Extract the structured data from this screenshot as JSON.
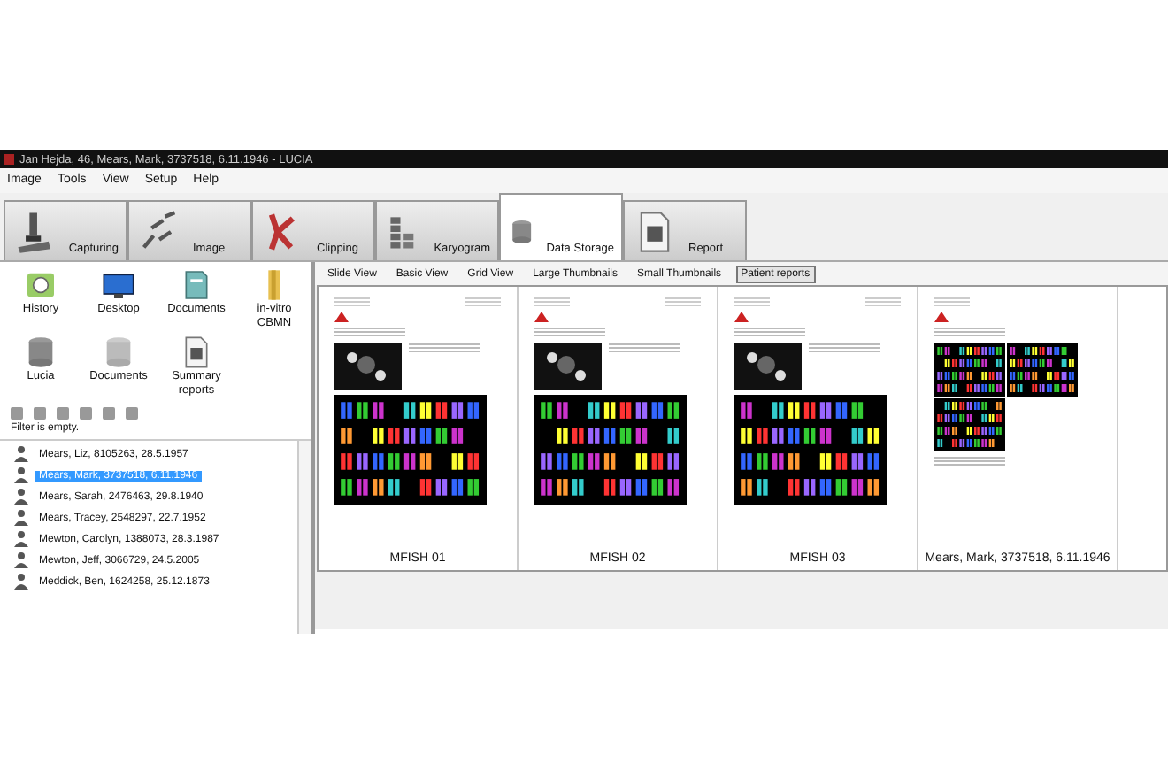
{
  "window": {
    "title": "Jan Hejda, 46, Mears, Mark, 3737518, 6.11.1946 - LUCIA"
  },
  "menu": [
    "Image",
    "Tools",
    "View",
    "Setup",
    "Help"
  ],
  "tabs": [
    {
      "label": "Capturing",
      "kind": "microscope",
      "selected": false
    },
    {
      "label": "Image",
      "kind": "chromosomes",
      "selected": false
    },
    {
      "label": "Clipping",
      "kind": "clip",
      "selected": false
    },
    {
      "label": "Karyogram",
      "kind": "karyogram",
      "selected": false
    },
    {
      "label": "Data Storage",
      "kind": "database",
      "selected": true
    },
    {
      "label": "Report",
      "kind": "report",
      "selected": false
    }
  ],
  "shortcuts": [
    {
      "label": "History",
      "kind": "history"
    },
    {
      "label": "Desktop",
      "kind": "desktop"
    },
    {
      "label": "Documents",
      "kind": "documents"
    },
    {
      "label": "in-vitro CBMN",
      "kind": "folder"
    },
    {
      "label": "Lucia",
      "kind": "database"
    },
    {
      "label": "Documents",
      "kind": "database-grey"
    },
    {
      "label": "Summary reports",
      "kind": "report"
    }
  ],
  "filter_status": "Filter is empty.",
  "patients": [
    {
      "name": "Mears, Liz, 8105263, 28.5.1957",
      "selected": false
    },
    {
      "name": "Mears, Mark, 3737518, 6.11.1946",
      "selected": true
    },
    {
      "name": "Mears, Sarah, 2476463, 29.8.1940",
      "selected": false
    },
    {
      "name": "Mears, Tracey, 2548297, 22.7.1952",
      "selected": false
    },
    {
      "name": "Mewton, Carolyn, 1388073, 28.3.1987",
      "selected": false
    },
    {
      "name": "Mewton, Jeff, 3066729, 24.5.2005",
      "selected": false
    },
    {
      "name": "Meddick, Ben, 1624258, 25.12.1873",
      "selected": false
    }
  ],
  "view_toolbar": [
    {
      "label": "Slide View",
      "selected": false
    },
    {
      "label": "Basic View",
      "selected": false
    },
    {
      "label": "Grid View",
      "selected": false
    },
    {
      "label": "Large Thumbnails",
      "selected": false
    },
    {
      "label": "Small Thumbnails",
      "selected": false
    },
    {
      "label": "Patient reports",
      "selected": true
    }
  ],
  "reports": [
    {
      "caption": "MFISH 01",
      "kind": "mfish"
    },
    {
      "caption": "MFISH 02",
      "kind": "mfish"
    },
    {
      "caption": "MFISH 03",
      "kind": "mfish"
    },
    {
      "caption": "Mears, Mark, 3737518, 6.11.1946",
      "kind": "summary"
    }
  ]
}
